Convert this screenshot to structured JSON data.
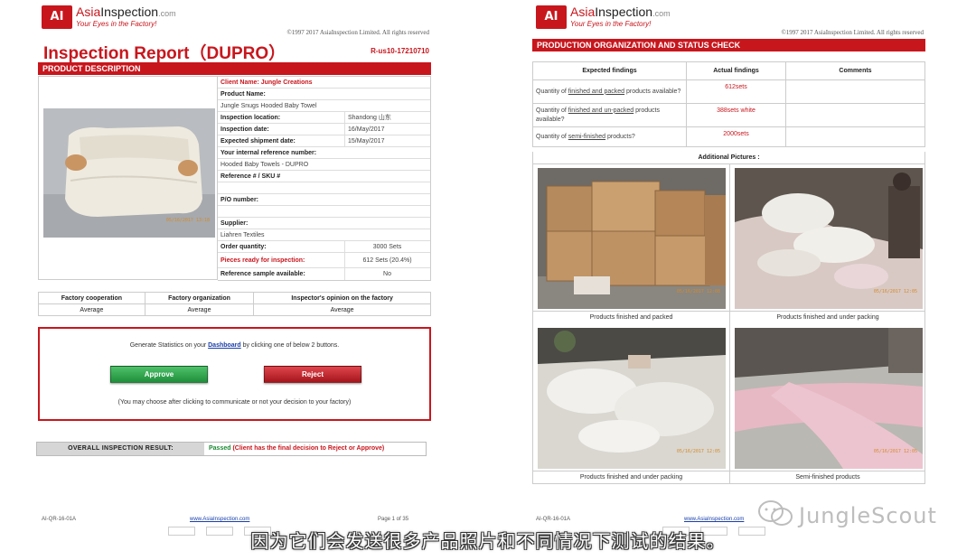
{
  "left_page": {
    "logo": {
      "badge": "AI",
      "name_asia": "Asia",
      "name_inspection": "Inspection",
      "name_com": ".com",
      "slogan": "Your Eyes in the Factory!"
    },
    "copyright": "©1997 2017 AsiaInspection Limited. All rights reserved",
    "title": "Inspection Report（DUPRO）",
    "ref": "R-us10-17210710",
    "section_product": "PRODUCT DESCRIPTION",
    "photo_stamp": "05/16/2017 13:18",
    "client": "Client Name: Jungle Creations",
    "product_name_label": "Product Name:",
    "product_name": "Jungle Snugs Hooded Baby Towel",
    "location_label": "Inspection location:",
    "location_value": "Shandong 山东",
    "date_label": "Inspection date:",
    "date_value": "16/May/2017",
    "shipment_label": "Expected shipment date:",
    "shipment_value": "15/May/2017",
    "internal_ref_label": "Your internal reference number:",
    "internal_ref_value": "Hooded Baby Towels - DUPRO",
    "sku_label": "Reference # / SKU #",
    "po_label": "P/O number:",
    "supplier_label": "Supplier:",
    "supplier_value": "Liahren Textiles",
    "order_qty_label": "Order quantity:",
    "order_qty_value": "3000 Sets",
    "ready_label": "Pieces ready for inspection:",
    "ready_value": "612 Sets (20.4%)",
    "ref_sample_label": "Reference sample available:",
    "ref_sample_value": "No",
    "factory": {
      "headers": [
        "Factory cooperation",
        "Factory organization",
        "Inspector's opinion on the factory"
      ],
      "values": [
        "Average",
        "Average",
        "Average"
      ]
    },
    "dashboard": {
      "text_before": "Generate Statistics on your ",
      "link": "Dashboard",
      "text_after": " by clicking one of below 2 buttons.",
      "approve": "Approve",
      "reject": "Reject",
      "note": "(You may choose after clicking to communicate or not your decision to your factory)"
    },
    "overall": {
      "label": "OVERALL INSPECTION RESULT:",
      "status": "Passed",
      "note": " (Client has the final decision to Reject or Approve)"
    },
    "footer": {
      "code": "AI-QR-16-01A",
      "link": "www.AsiaInspection.com",
      "page": "Page 1 of 35"
    }
  },
  "right_page": {
    "logo": {
      "badge": "AI",
      "name_asia": "Asia",
      "name_inspection": "Inspection",
      "name_com": ".com",
      "slogan": "Your Eyes in the Factory!"
    },
    "copyright": "©1997 2017 AsiaInspection Limited. All rights reserved",
    "section": "PRODUCTION ORGANIZATION AND STATUS CHECK",
    "headers": [
      "Expected findings",
      "Actual findings",
      "Comments"
    ],
    "rows": [
      {
        "q_pre": "Quantity of ",
        "q_u": "finished and packed",
        "q_post": " products available?",
        "a": "612sets"
      },
      {
        "q_pre": "Quantity of ",
        "q_u": "finished and un-packed",
        "q_post": " products available?",
        "a": "388sets white"
      },
      {
        "q_pre": "Quantity of ",
        "q_u": "semi-finished",
        "q_post": " products?",
        "a": "2000sets"
      }
    ],
    "additional": "Additional    Pictures :",
    "pictures": [
      {
        "caption": "Products finished and packed",
        "stamp": "05/16/2017 12:08"
      },
      {
        "caption": "Products finished and under packing",
        "stamp": "05/16/2017 12:05"
      },
      {
        "caption": "Products finished and under packing",
        "stamp": "05/16/2017 12:05"
      },
      {
        "caption": "Semi-finished products",
        "stamp": "05/16/2017 12:05"
      }
    ],
    "footer": {
      "code": "AI-QR-16-01A",
      "link": "www.AsiaInspection.com"
    }
  },
  "subtitle": "因为它们会发送很多产品照片和不同情况下测试的结果。",
  "watermark": "JungleScout",
  "colors": {
    "brand_red": "#c8161d",
    "pass_green": "#1c8a33",
    "link_blue": "#1a3fa8"
  }
}
